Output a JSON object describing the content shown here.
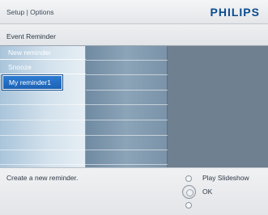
{
  "header": {
    "breadcrumb": "Setup | Options",
    "brand": "PHILIPS"
  },
  "page": {
    "title": "Event Reminder"
  },
  "menu": {
    "items": [
      {
        "label": "New reminder",
        "selected": false
      },
      {
        "label": "Snooze",
        "selected": false
      },
      {
        "label": "My reminder1",
        "selected": true
      }
    ]
  },
  "footer": {
    "help_text": "Create a new reminder.",
    "controls": {
      "up_label": "Play Slideshow",
      "center_label": "OK"
    }
  },
  "colors": {
    "brand": "#0b4c8f",
    "selection": "#1c62b4"
  }
}
